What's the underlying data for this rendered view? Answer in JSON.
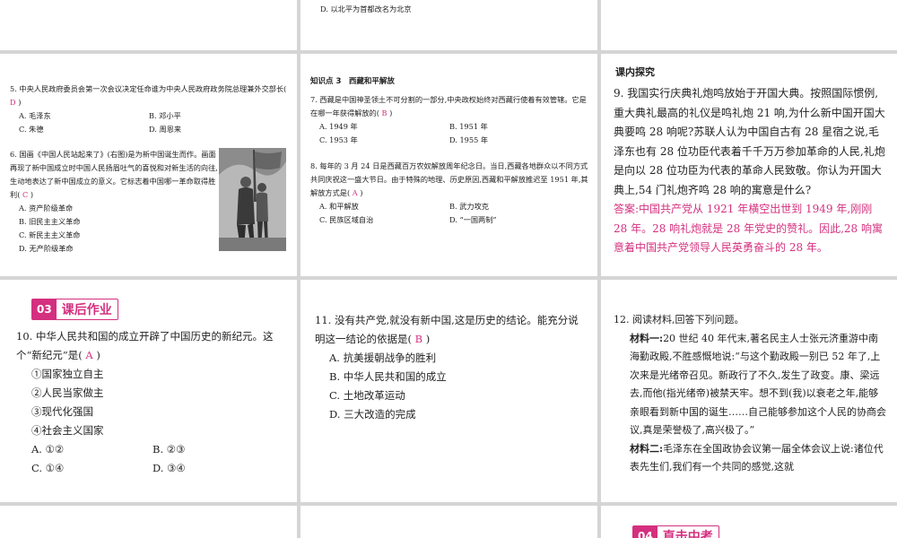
{
  "top_mid": {
    "option_d": "D. 以北平为首都改名为北京"
  },
  "q5": {
    "text": "5. 中央人民政府委员会第一次会议决定任命谁为中央人民政府政务院总理兼外交部长(",
    "answer": "D",
    "close": ")",
    "options": [
      "A. 毛泽东",
      "B. 邓小平",
      "C. 朱德",
      "D. 周恩来"
    ]
  },
  "q6": {
    "text": "6. 国画《中国人民站起来了》(右图)是为新中国诞生而作。画面再现了新中国成立时中国人民扬眉吐气的喜悦和对新生活的向往,生动地表达了新中国成立的意义。它标志着中国哪一革命取得胜利(",
    "answer": "C",
    "close": ")",
    "options": [
      "A. 资产阶级革命",
      "B. 旧民主主义革命",
      "C. 新民主主义革命",
      "D. 无产阶级革命"
    ]
  },
  "knowledge3": {
    "title": "知识点 3　西藏和平解放"
  },
  "q7": {
    "text": "7. 西藏是中国神圣领土不可分割的一部分,中央政权始终对西藏行使着有效管辖。它是在哪一年获得解放的(",
    "answer": "B",
    "close": ")",
    "options": [
      "A. 1949 年",
      "B. 1951 年",
      "C. 1953 年",
      "D. 1955 年"
    ]
  },
  "q8": {
    "text": "8. 每年的 3 月 24 日是西藏百万农奴解放周年纪念日。当日,西藏各地群众以不同方式共同庆祝这一盛大节日。由于特殊的地理、历史原因,西藏和平解放推迟至 1951 年,其解放方式是(",
    "answer": "A",
    "close": ")",
    "options": [
      "A. 和平解放",
      "B. 武力攻克",
      "C. 民族区域自治",
      "D. “一国两制”"
    ]
  },
  "explore": {
    "title": "课内探究",
    "q9": "9. 我国实行庆典礼炮鸣放始于开国大典。按照国际惯例,重大典礼最高的礼仪是鸣礼炮 21 响,为什么新中国开国大典要鸣 28 响呢?苏联人认为中国自古有 28 星宿之说,毛泽东也有 28 位功臣代表着千千万万参加革命的人民,礼炮是向以 28 位功臣为代表的革命人民致敬。你认为开国大典上,54 门礼炮齐鸣 28 响的寓意是什么?",
    "answer": "答案:中国共产党从 1921 年横空出世到 1949 年,刚刚 28 年。28 响礼炮就是 28 年党史的赞礼。因此,28 响寓意着中国共产党领导人民英勇奋斗的 28 年。"
  },
  "homework": {
    "num": "03",
    "title": "课后作业",
    "q10": {
      "text": "10. 中华人民共和国的成立开辟了中国历史的新纪元。这个“新纪元”是(",
      "answer": "A",
      "close": ")",
      "items": [
        "①国家独立自主",
        "②人民当家做主",
        "③现代化强国",
        "④社会主义国家"
      ],
      "options": [
        "A. ①②",
        "B. ②③",
        "C. ①④",
        "D. ③④"
      ]
    }
  },
  "q11": {
    "text": "11. 没有共产党,就没有新中国,这是历史的结论。能充分说明这一结论的依据是(",
    "answer": "B",
    "close": ")",
    "options": [
      "A. 抗美援朝战争的胜利",
      "B. 中华人民共和国的成立",
      "C. 土地改革运动",
      "D. 三大改造的完成"
    ]
  },
  "q12": {
    "text": "12. 阅读材料,回答下列问题。",
    "m1_label": "材料一:",
    "m1": "20 世纪 40 年代末,著名民主人士张元济重游中南海勤政殿,不胜感慨地说:“与这个勤政殿一别已 52 年了,上次来是光绪帝召见。新政行了不久,发生了政变。康、梁远去,而他(指光绪帝)被禁天牢。想不到(我)以衰老之年,能够亲眼看到新中国的诞生……自己能够参加这个人民的协商会议,真是荣誉极了,高兴极了。”",
    "m2_label": "材料二:",
    "m2": "毛泽东在全国政协会议第一届全体会议上说:诸位代表先生们,我们有一个共同的感觉,这就"
  },
  "zhongkao": {
    "num": "04",
    "title": "直击中考"
  },
  "colors": {
    "accent": "#d4307f",
    "gap": "#d5d5d5"
  }
}
